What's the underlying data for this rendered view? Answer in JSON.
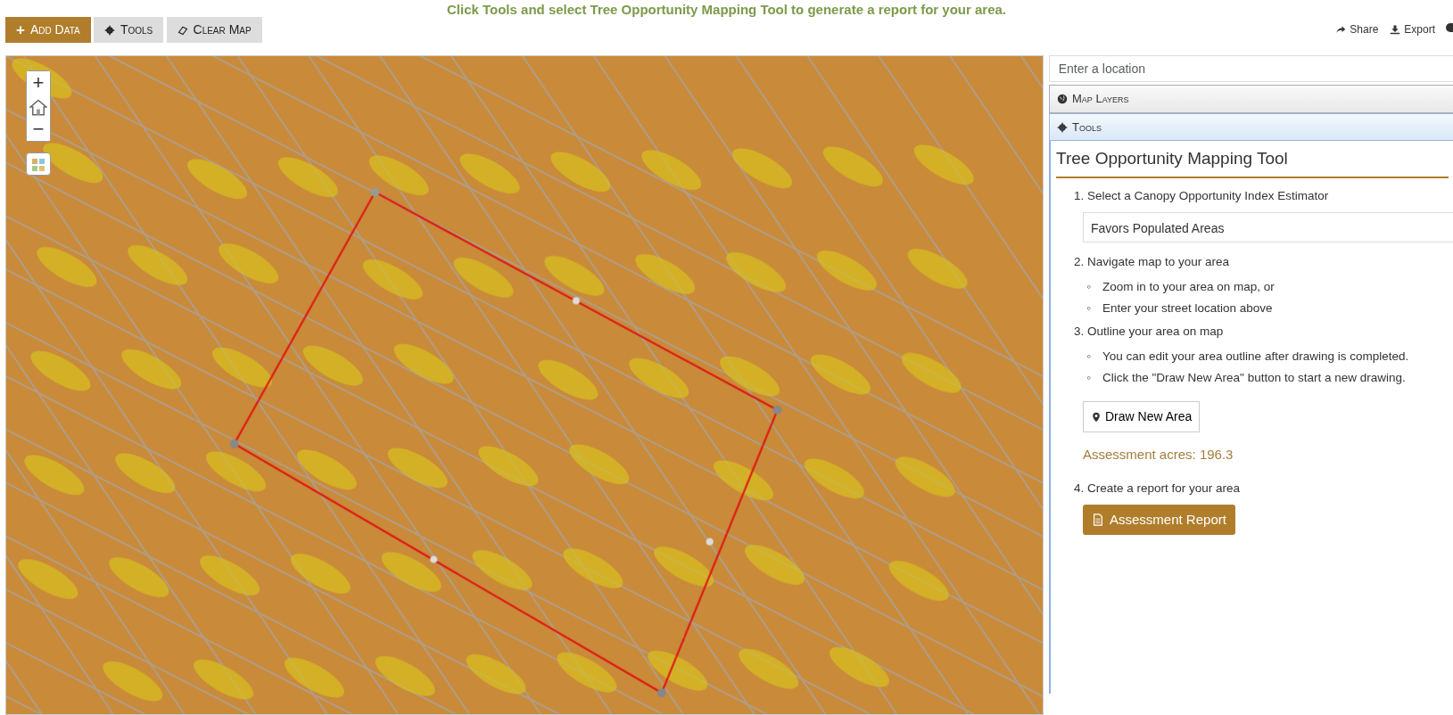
{
  "banner": "Click Tools and select Tree Opportunity Mapping Tool to generate a report for your area.",
  "toolbar": {
    "buttons": [
      {
        "label": "Add Data",
        "mark": "+",
        "selected": true
      },
      {
        "label": "Tools",
        "selected": false
      },
      {
        "label": "Clear Map",
        "selected": false
      }
    ],
    "links": [
      {
        "label": "Share"
      },
      {
        "label": "Export"
      }
    ]
  },
  "map": {
    "zoom_in": "+",
    "zoom_out": "−"
  },
  "sidebar": {
    "search": {
      "placeholder": "Enter a location"
    },
    "panels": [
      {
        "title": "Map Layers",
        "expanded": false
      },
      {
        "title": "Tools",
        "expanded": true
      }
    ],
    "tool": {
      "title": "Tree Opportunity Mapping Tool",
      "steps": [
        {
          "text": "1. Select a Canopy Opportunity Index Estimator",
          "kind": "select",
          "value": "Favors Populated Areas"
        },
        {
          "text": "2. Navigate map to your area",
          "bullets": [
            {
              "marker": "◦",
              "text": "Zoom in to your area on map, or"
            },
            {
              "marker": "◦",
              "text": "Enter your street location above"
            }
          ],
          "kind": "list"
        },
        {
          "text": "3. Outline your area on map",
          "bullets": [
            {
              "marker": "◦",
              "text": "You can edit your area outline after drawing is completed."
            },
            {
              "marker": "◦",
              "text": "Click the \"Draw New Area\" button to start a new drawing."
            }
          ],
          "kind": "draw",
          "button": "Draw New Area",
          "result": "Assessment acres: 196.3"
        },
        {
          "text": "4. Create a report for your area",
          "kind": "report",
          "button": "Assessment Report"
        }
      ]
    }
  }
}
